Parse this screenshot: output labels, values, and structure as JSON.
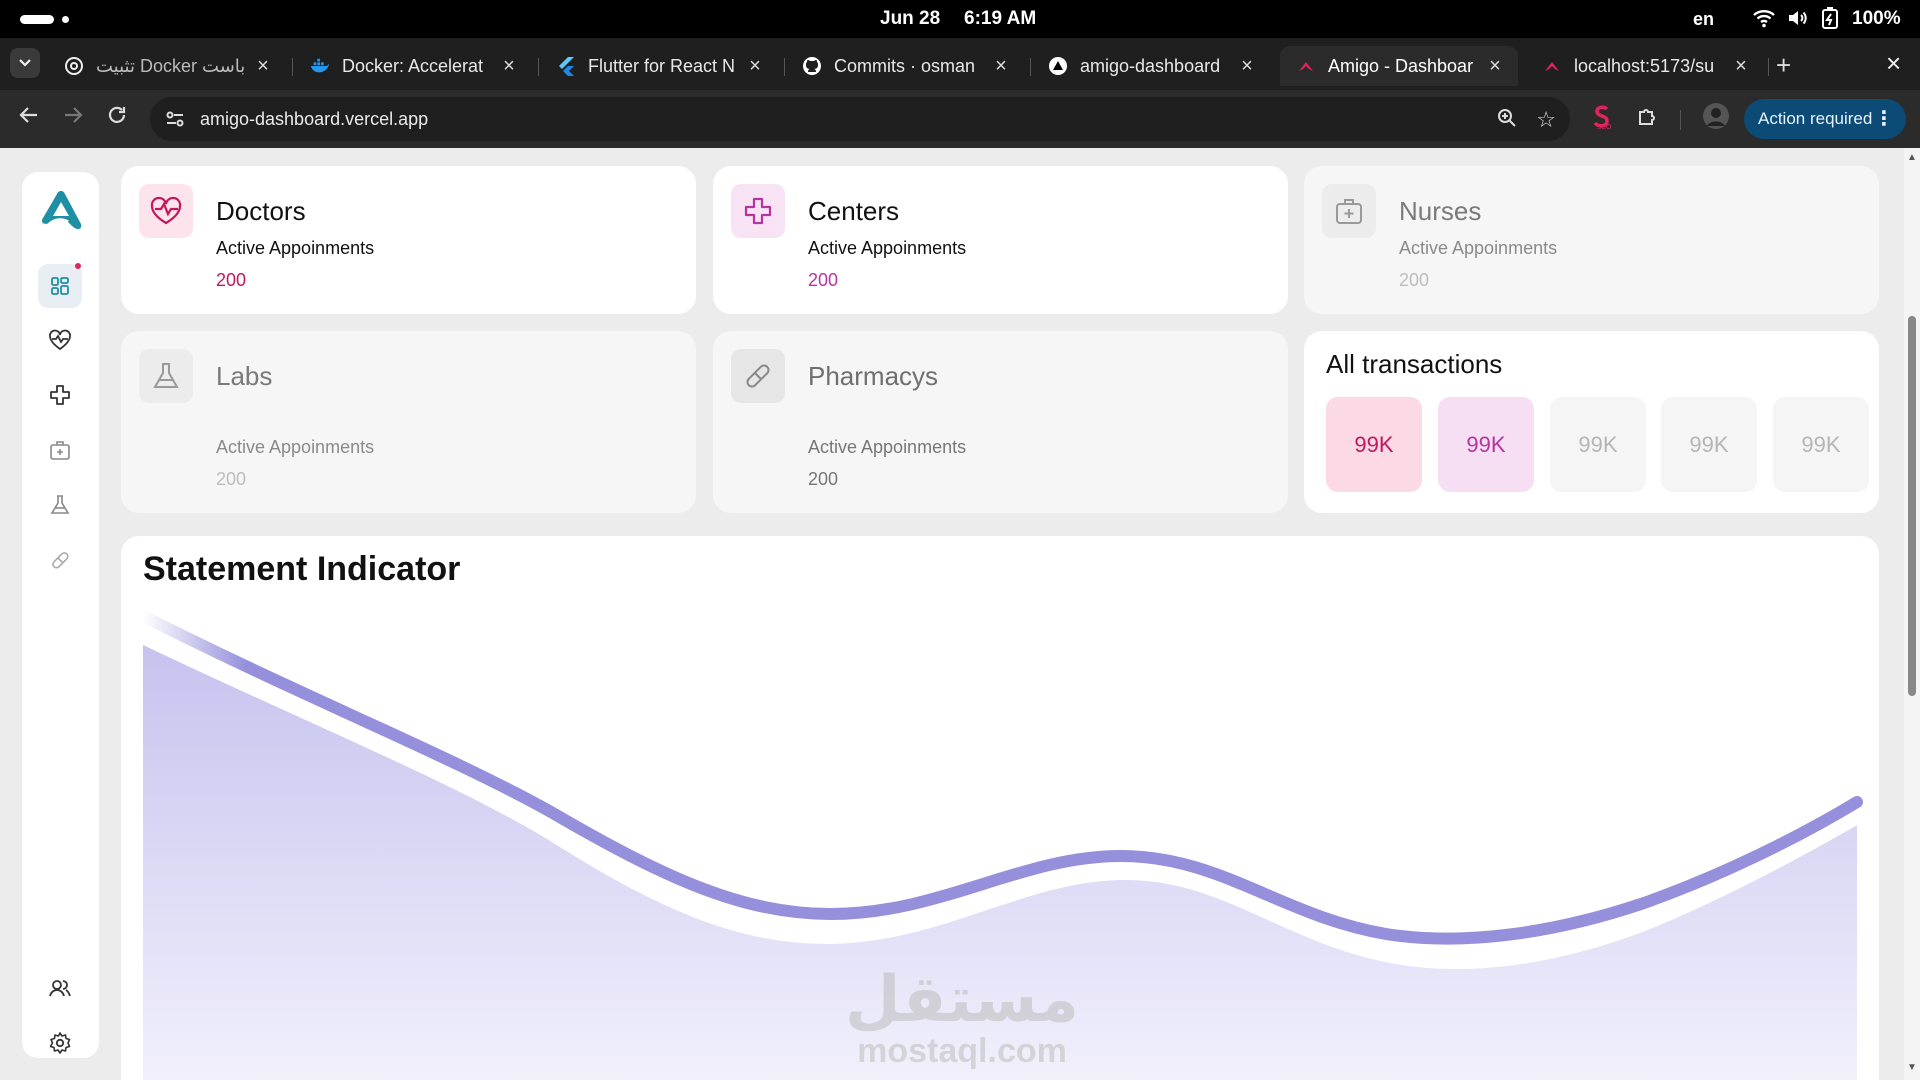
{
  "os": {
    "date": "Jun 28",
    "time": "6:19 AM",
    "lang": "en",
    "battery": "100%"
  },
  "tabs": [
    {
      "title": "تثبيت Docker باست",
      "icon": "openai-icon"
    },
    {
      "title": "Docker: Accelerat",
      "icon": "docker-icon"
    },
    {
      "title": "Flutter for React N",
      "icon": "flutter-icon"
    },
    {
      "title": "Commits · osman",
      "icon": "github-icon"
    },
    {
      "title": "amigo-dashboard",
      "icon": "vercel-icon"
    },
    {
      "title": "Amigo - Dashboar",
      "icon": "amigo-icon",
      "active": true
    },
    {
      "title": "localhost:5173/su",
      "icon": "amigo-icon"
    }
  ],
  "toolbar": {
    "url": "amigo-dashboard.vercel.app",
    "action_label": "Action required"
  },
  "cards": [
    {
      "name": "Doctors",
      "sub": "Active Appoinments",
      "value": "200",
      "accent": "#c2185b"
    },
    {
      "name": "Centers",
      "sub": "Active Appoinments",
      "value": "200",
      "accent": "#b4359f"
    },
    {
      "name": "Nurses",
      "sub": "Active Appoinments",
      "value": "200"
    },
    {
      "name": "Labs",
      "sub": "Active Appoinments",
      "value": "200"
    },
    {
      "name": "Pharmacys",
      "sub": "Active Appoinments",
      "value": "200"
    }
  ],
  "transactions": {
    "title": "All transactions",
    "tiles": [
      "99K",
      "99K",
      "99K",
      "99K",
      "99K"
    ]
  },
  "chart": {
    "title": "Statement Indicator",
    "color": "#9690dc"
  },
  "watermark": {
    "arabic": "مستقل",
    "latin": "mostaql.com"
  }
}
